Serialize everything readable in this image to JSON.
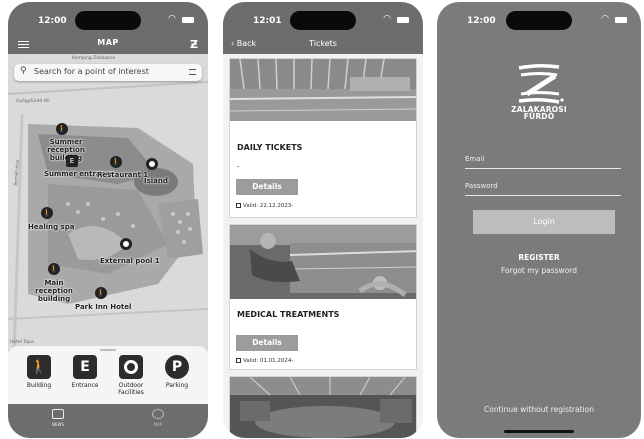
{
  "map_screen": {
    "status_time": "12:00",
    "title": "MAP",
    "search_placeholder": "Search for a point of interest",
    "road_labels": [
      "Kemping Zalakaros",
      "Gyógyfürdő tér",
      "Termál utca",
      "Hotel Tapa"
    ],
    "places": [
      {
        "label": "Summer reception building",
        "icon": "person-walking-icon"
      },
      {
        "label": "Summer entrance",
        "icon": "entrance-icon"
      },
      {
        "label": "Restaurant 1",
        "icon": "person-walking-icon"
      },
      {
        "label": "Island",
        "icon": "circle-pin-icon"
      },
      {
        "label": "Healing spa",
        "icon": "person-walking-icon"
      },
      {
        "label": "External pool 1",
        "icon": "circle-pin-icon"
      },
      {
        "label": "Main reception building",
        "icon": "person-walking-icon"
      },
      {
        "label": "Park Inn Hotel",
        "icon": "person-walking-icon"
      }
    ],
    "filters": [
      {
        "label": "Building",
        "icon": "person-walking-icon"
      },
      {
        "label": "Entrance",
        "icon": "entrance-icon"
      },
      {
        "label": "Outdoor Facilities",
        "icon": "circle-icon"
      },
      {
        "label": "Parking",
        "icon": "parking-icon"
      }
    ],
    "tabs": [
      {
        "label": "NEWS",
        "icon": "news-icon"
      },
      {
        "label": "MAP",
        "icon": "map-icon"
      }
    ]
  },
  "tickets_screen": {
    "status_time": "12:01",
    "back_label": "Back",
    "title": "Tickets",
    "cards": [
      {
        "title": "DAILY TICKETS",
        "dash": "-",
        "button": "Details",
        "valid": "Valid: 22.12.2023-"
      },
      {
        "title": "MEDICAL TREATMENTS",
        "button": "Details",
        "valid": "Valid: 01.01.2024-"
      }
    ]
  },
  "login_screen": {
    "status_time": "12:00",
    "brand_line1": "ZALAKAROSI",
    "brand_line2": "FÜRDŐ",
    "email_label": "Email",
    "password_label": "Password",
    "login_button": "Login",
    "register_link": "REGISTER",
    "forgot_link": "Forgot my password",
    "continue_link": "Continue without registration"
  },
  "colors": {
    "topbar": "#6d6d6d",
    "login_bg": "#7b7b7b",
    "button_gray": "#9c9c9c"
  }
}
